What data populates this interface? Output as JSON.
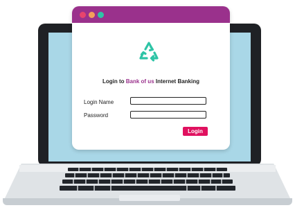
{
  "window": {
    "traffic_lights": [
      "red",
      "orange",
      "green"
    ],
    "titlebar_color": "#9a318c"
  },
  "logo": {
    "icon": "recycle-icon",
    "color": "#2ec4a6"
  },
  "login": {
    "heading_prefix": "Login to ",
    "heading_brand": "Bank of us",
    "heading_suffix": " Internet Banking",
    "username_label": "Login Name",
    "username_value": "",
    "password_label": "Password",
    "password_value": "",
    "submit_label": "Login"
  },
  "colors": {
    "accent": "#9a318c",
    "button": "#e0115f",
    "screen": "#a9d7e7"
  }
}
